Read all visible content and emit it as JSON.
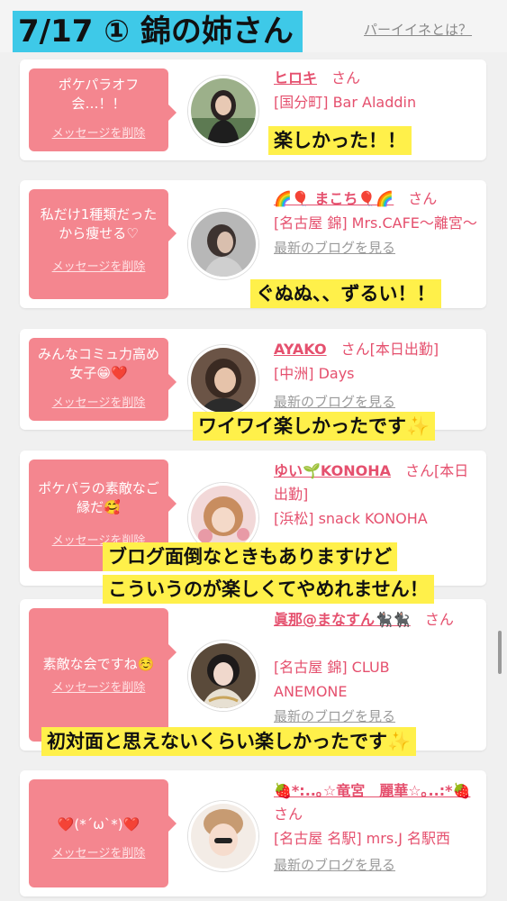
{
  "header": {
    "title": "7/17 ① 錦の姉さん",
    "about_link": "パーイイネとは？"
  },
  "common": {
    "delete_label": "メッセージを削除",
    "san": "さん",
    "blog_link": "最新のブログを見る"
  },
  "cards": [
    {
      "message": "ポケパラオフ会…！！",
      "name": "ヒロキ",
      "shop": "[国分町] Bar Aladdin",
      "highlight": "楽しかった！！"
    },
    {
      "message": "私だけ1種類だったから痩せる♡",
      "name": "🌈🎈 まこち🎈🌈",
      "shop": "[名古屋 錦] Mrs.CAFE〜離宮〜",
      "highlight": "ぐぬぬ、、ずるい！！"
    },
    {
      "message": "みんなコミュ力高め女子😁❤️",
      "name": "AYAKO",
      "status": "[本日出勤]",
      "shop": "[中洲] Days",
      "highlight": "ワイワイ楽しかったです✨"
    },
    {
      "message": "ポケパラの素敵なご縁だ🥰",
      "name": "ゆい🌱KONOHA",
      "status": "[本日出勤]",
      "shop": "[浜松] snack KONOHA",
      "highlight_lines": [
        "ブログ面倒なときもありますけど",
        "こういうのが楽しくてやめれません！"
      ]
    },
    {
      "message": "素敵な会ですね☺️",
      "name": "眞那@まなすん🐈‍⬛🐈‍⬛",
      "shop": "[名古屋 錦] CLUB ANEMONE",
      "highlight": "初対面と思えないくらい楽しかったです✨"
    },
    {
      "message": "❤️(*´ω`*)❤️",
      "name": "🍓*:..｡☆竜宮　麗華☆｡..:*🍓",
      "shop": "[名古屋 名駅] mrs.J 名駅西"
    }
  ],
  "colors": {
    "accent_pink": "#e5506e",
    "bubble_pink": "#f4868f",
    "title_cyan": "#3ec9e8",
    "highlight_yellow": "#fff04a"
  }
}
